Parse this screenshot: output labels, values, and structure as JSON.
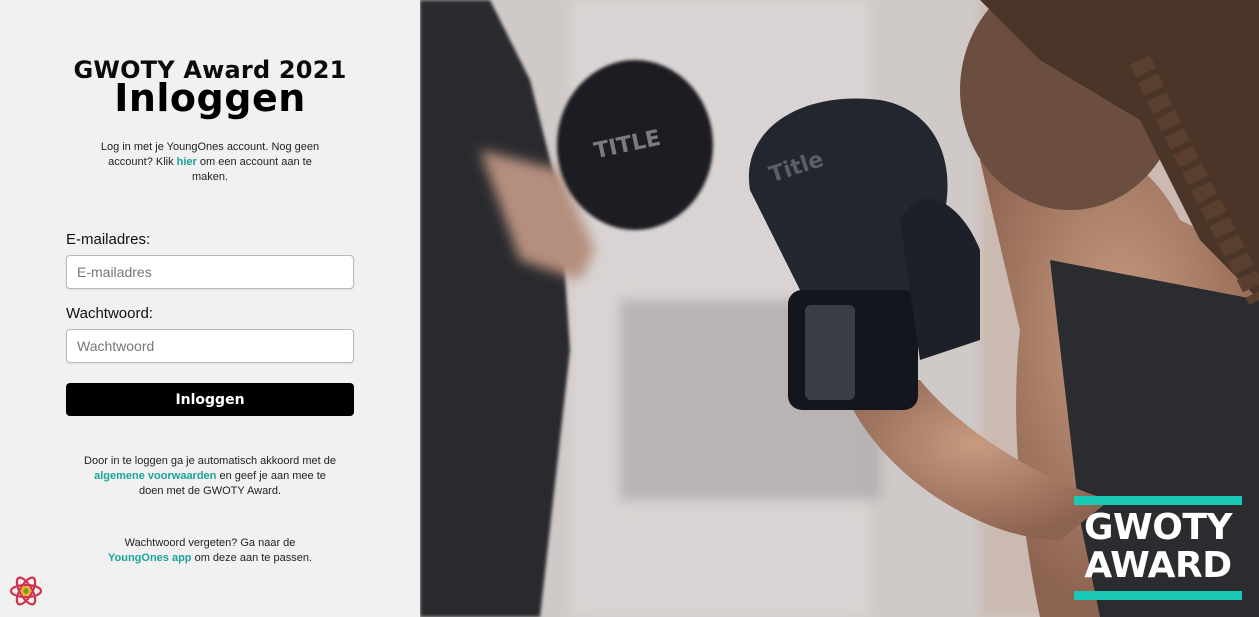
{
  "header": {
    "event_title": "GWOTY Award 2021",
    "page_title": "Inloggen"
  },
  "intro": {
    "text_before": "Log in met je YoungOnes account. Nog geen account? Klik ",
    "link": "hier",
    "text_after": " om een account aan te maken."
  },
  "form": {
    "email_label": "E-mailadres:",
    "email_placeholder": "E-mailadres",
    "email_value": "",
    "password_label": "Wachtwoord:",
    "password_placeholder": "Wachtwoord",
    "password_value": "",
    "submit_label": "Inloggen"
  },
  "terms": {
    "text_before": "Door in te loggen ga je automatisch akkoord met de ",
    "link": "algemene voorwaarden",
    "text_after": " en geef je aan mee te doen met de GWOTY Award."
  },
  "forgot": {
    "text_before": "Wachtwoord vergeten? Ga naar de ",
    "link": "YoungOnes app",
    "text_after": " om deze aan te passen."
  },
  "badge": {
    "line1": "GWOTY",
    "line2": "AWARD"
  },
  "icons": {
    "react": "react-atom-icon"
  },
  "colors": {
    "accent": "#1aa59a",
    "badge_accent": "#19c9b6",
    "button": "#000000"
  }
}
